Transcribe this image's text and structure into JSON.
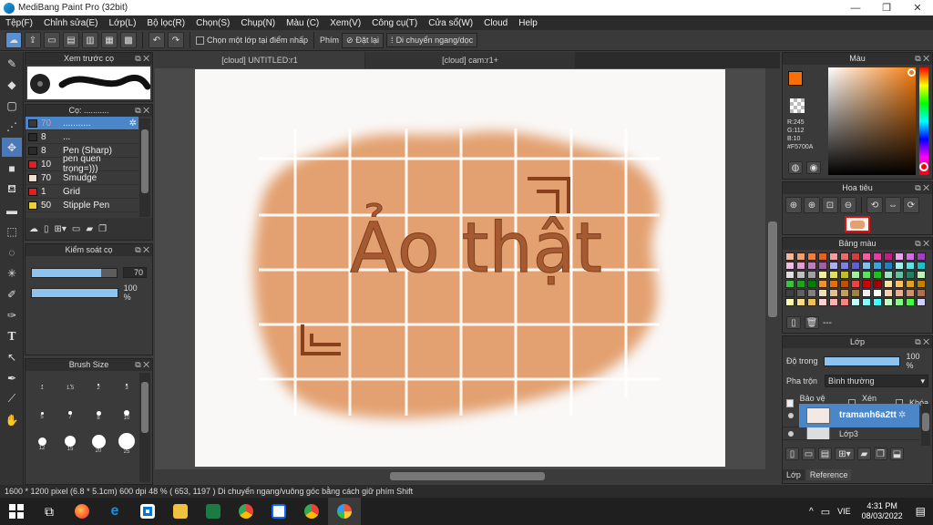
{
  "window": {
    "title": "MediBang Paint Pro (32bit)"
  },
  "menu": [
    "Tệp(F)",
    "Chỉnh sửa(E)",
    "Lớp(L)",
    "Bộ lọc(R)",
    "Chọn(S)",
    "Chụp(N)",
    "Màu (C)",
    "Xem(V)",
    "Công cụ(T)",
    "Cửa sổ(W)",
    "Cloud",
    "Help"
  ],
  "toolbar": {
    "select_layer_label": "Chọn một lớp tại điểm nhấp",
    "key_label": "Phím",
    "reset_label": "Đặt lại",
    "move_label": "Di chuyển ngang/dọc"
  },
  "brush_preview": {
    "title": "Xem trước cọ"
  },
  "brush_panel": {
    "title": "Cọ: ...........",
    "items": [
      {
        "size": "70",
        "name": "...........",
        "color": "#3a3a3a"
      },
      {
        "size": "8",
        "name": "...",
        "color": "#2a2a2a"
      },
      {
        "size": "8",
        "name": "Pen (Sharp)",
        "color": "#2a2a2a"
      },
      {
        "size": "10",
        "name": "pen quen trọng=)))",
        "color": "#e02020"
      },
      {
        "size": "70",
        "name": "Smudge",
        "color": "#f3e0cc"
      },
      {
        "size": "1",
        "name": "Grid",
        "color": "#e02020"
      },
      {
        "size": "50",
        "name": "Stipple Pen",
        "color": "#e8d040"
      }
    ]
  },
  "brush_control": {
    "title": "Kiểm soát cọ",
    "size_value": "70",
    "size_fraction": 0.82,
    "opacity_value": "100 %",
    "opacity_fraction": 1.0
  },
  "brush_size": {
    "title": "Brush Size",
    "labels": [
      "1",
      "1.5",
      "2",
      "3",
      "5",
      "7",
      "8",
      "10",
      "12",
      "15",
      "20",
      "25"
    ]
  },
  "tabs": [
    "[cloud] UNTITLED:r1",
    "[cloud] cam:r1+"
  ],
  "canvas": {
    "text": "Ảo thật"
  },
  "color_panel": {
    "title": "Màu",
    "r": "R:245",
    "g": "G:112",
    "b": "B:10",
    "hex": "#F5700A",
    "primary": "#f5700a"
  },
  "navigator": {
    "title": "Hoa tiêu"
  },
  "palette": {
    "title": "Bảng màu",
    "footer": "---"
  },
  "layer_panel": {
    "title": "Lớp",
    "opacity_label": "Độ trong",
    "opacity_value": "100 %",
    "blend_label": "Pha trộn",
    "blend_value": "Bình thường",
    "protect_alpha": "Bảo vệ alpha",
    "clip": "Xén bớt",
    "lock": "Khóa",
    "layers": [
      {
        "name": "tramanh6a2tt"
      },
      {
        "name": "Lớp3"
      }
    ],
    "tab_layer": "Lớp",
    "tab_reference": "Reference"
  },
  "status": {
    "text": "1600 * 1200 pixel   (6.8 * 5.1cm)   600 dpi   48 %   ( 653, 1197 )   Di chuyển ngang/vuông góc bằng cách giữ phím Shift"
  },
  "taskbar": {
    "lang": "VIE",
    "time": "4:31 PM",
    "date": "08/03/2022"
  }
}
